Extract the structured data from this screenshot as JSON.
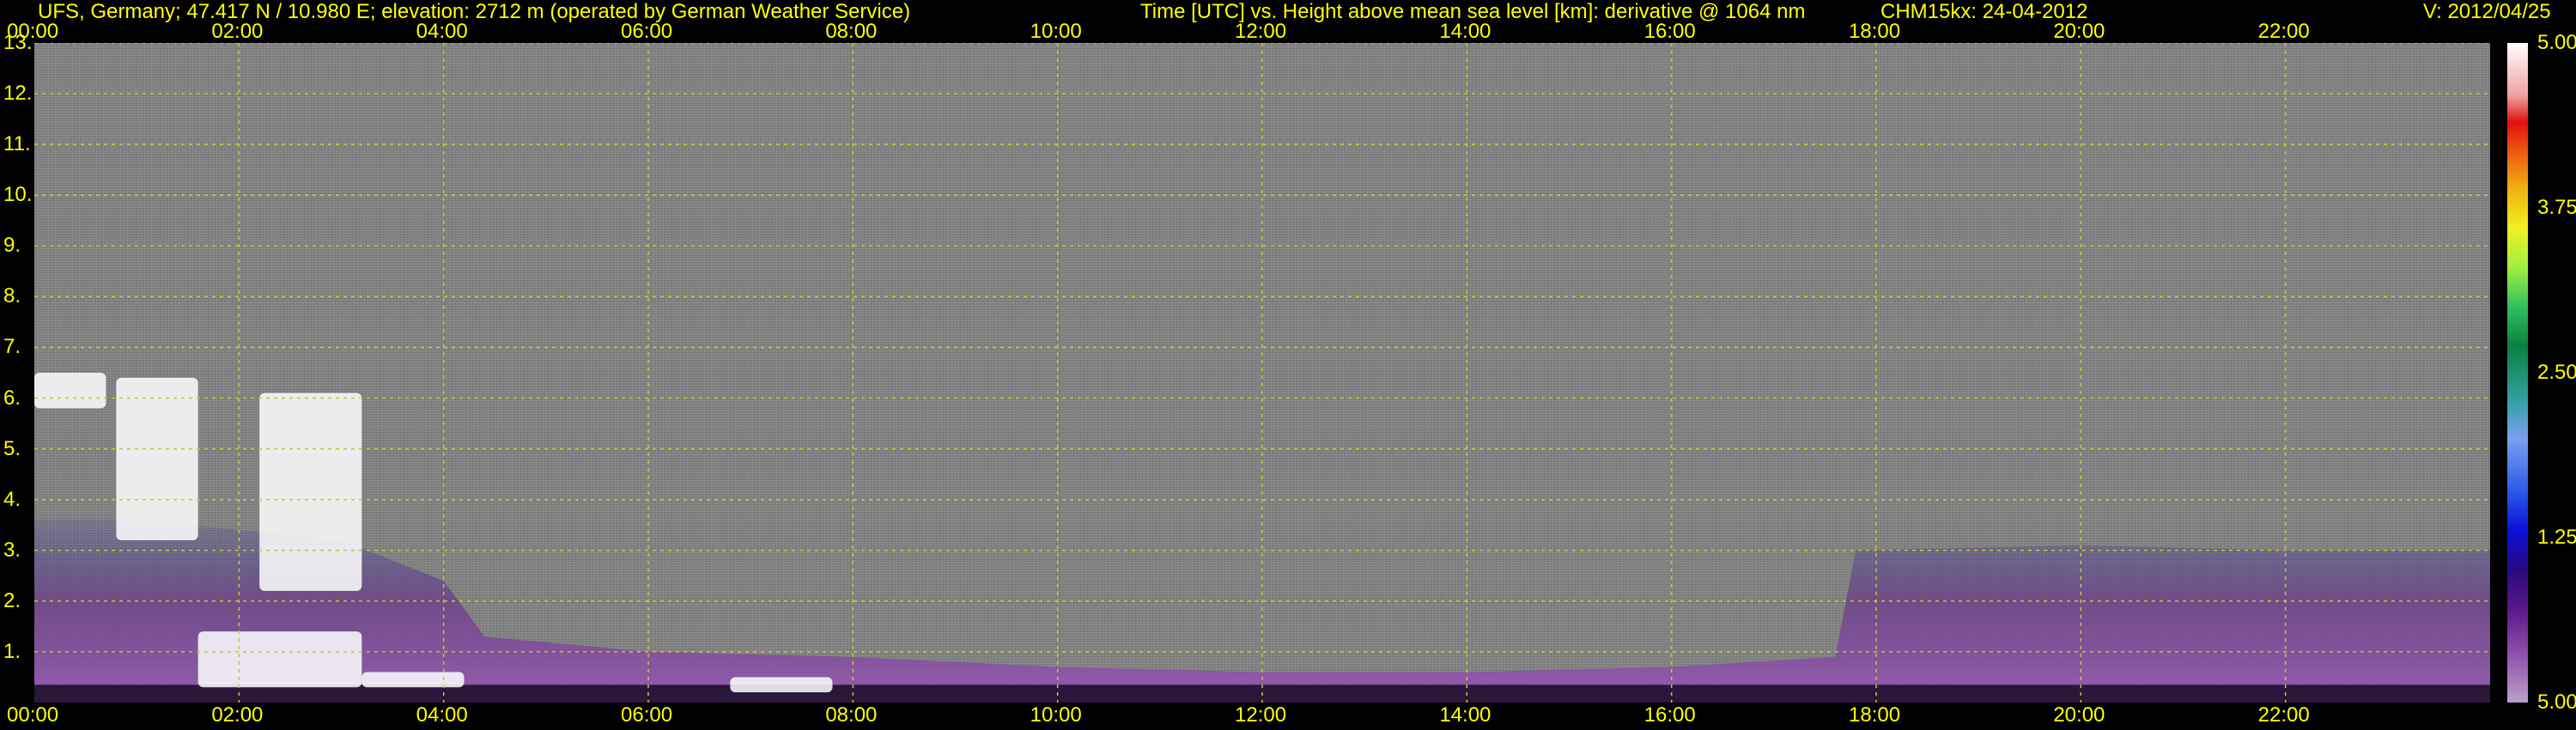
{
  "header": {
    "station": "UFS, Germany; 47.417 N / 10.980 E; elevation: 2712 m  (operated by German Weather Service)",
    "description": "Time [UTC] vs. Height above mean sea level [km]: derivative @ 1064 nm",
    "instrument": "CHM15kx: 24-04-2012",
    "version": "V: 2012/04/25"
  },
  "colors": {
    "text": "#ffff00",
    "grid": "#c8c832",
    "background": "#000000",
    "noise": "#7b7b7b",
    "boundary_layer": "#6a3a8a",
    "cloud": "#ffffff"
  },
  "colorbar": {
    "labels": [
      "5.00",
      "3.75",
      "2.50",
      "1.25",
      "5.00"
    ],
    "positions": [
      1.0,
      0.75,
      0.5,
      0.25,
      0.0
    ]
  },
  "chart_data": {
    "type": "heatmap",
    "xlabel": "Time [UTC]",
    "ylabel": "Height above mean sea level [km]",
    "xlim": [
      0,
      24
    ],
    "ylim": [
      0,
      13
    ],
    "xticks": [
      {
        "value": 0,
        "label": "00:00"
      },
      {
        "value": 2,
        "label": "02:00"
      },
      {
        "value": 4,
        "label": "04:00"
      },
      {
        "value": 6,
        "label": "06:00"
      },
      {
        "value": 8,
        "label": "08:00"
      },
      {
        "value": 10,
        "label": "10:00"
      },
      {
        "value": 12,
        "label": "12:00"
      },
      {
        "value": 14,
        "label": "14:00"
      },
      {
        "value": 16,
        "label": "16:00"
      },
      {
        "value": 18,
        "label": "18:00"
      },
      {
        "value": 20,
        "label": "20:00"
      },
      {
        "value": 22,
        "label": "22:00"
      }
    ],
    "yticks": [
      {
        "value": 1,
        "label": "1."
      },
      {
        "value": 2,
        "label": "2."
      },
      {
        "value": 3,
        "label": "3."
      },
      {
        "value": 4,
        "label": "4."
      },
      {
        "value": 5,
        "label": "5."
      },
      {
        "value": 6,
        "label": "6."
      },
      {
        "value": 7,
        "label": "7."
      },
      {
        "value": 8,
        "label": "8."
      },
      {
        "value": 9,
        "label": "9."
      },
      {
        "value": 10,
        "label": "10."
      },
      {
        "value": 11,
        "label": "11."
      },
      {
        "value": 12,
        "label": "12."
      },
      {
        "value": 13,
        "label": "13."
      }
    ],
    "grid": true,
    "boundary_layer": [
      {
        "t": 0,
        "h": 3.6
      },
      {
        "t": 1,
        "h": 3.6
      },
      {
        "t": 2,
        "h": 3.4
      },
      {
        "t": 3,
        "h": 3.2
      },
      {
        "t": 4,
        "h": 2.4
      },
      {
        "t": 4.4,
        "h": 1.3
      },
      {
        "t": 6,
        "h": 1.0
      },
      {
        "t": 8,
        "h": 0.9
      },
      {
        "t": 10,
        "h": 0.7
      },
      {
        "t": 12,
        "h": 0.6
      },
      {
        "t": 14,
        "h": 0.6
      },
      {
        "t": 16,
        "h": 0.7
      },
      {
        "t": 17.6,
        "h": 0.9
      },
      {
        "t": 17.8,
        "h": 3.0
      },
      {
        "t": 20,
        "h": 3.1
      },
      {
        "t": 22,
        "h": 3.0
      },
      {
        "t": 24,
        "h": 3.0
      }
    ],
    "cloud_features": [
      {
        "t_start": 0.0,
        "t_end": 0.7,
        "h_bottom": 5.8,
        "h_top": 6.5
      },
      {
        "t_start": 0.8,
        "t_end": 1.6,
        "h_bottom": 3.2,
        "h_top": 6.4
      },
      {
        "t_start": 2.2,
        "t_end": 3.2,
        "h_bottom": 2.2,
        "h_top": 6.1
      },
      {
        "t_start": 1.6,
        "t_end": 3.2,
        "h_bottom": 0.3,
        "h_top": 1.4
      },
      {
        "t_start": 3.2,
        "t_end": 4.2,
        "h_bottom": 0.3,
        "h_top": 0.6
      },
      {
        "t_start": 6.8,
        "t_end": 7.8,
        "h_bottom": 0.2,
        "h_top": 0.5
      }
    ]
  }
}
